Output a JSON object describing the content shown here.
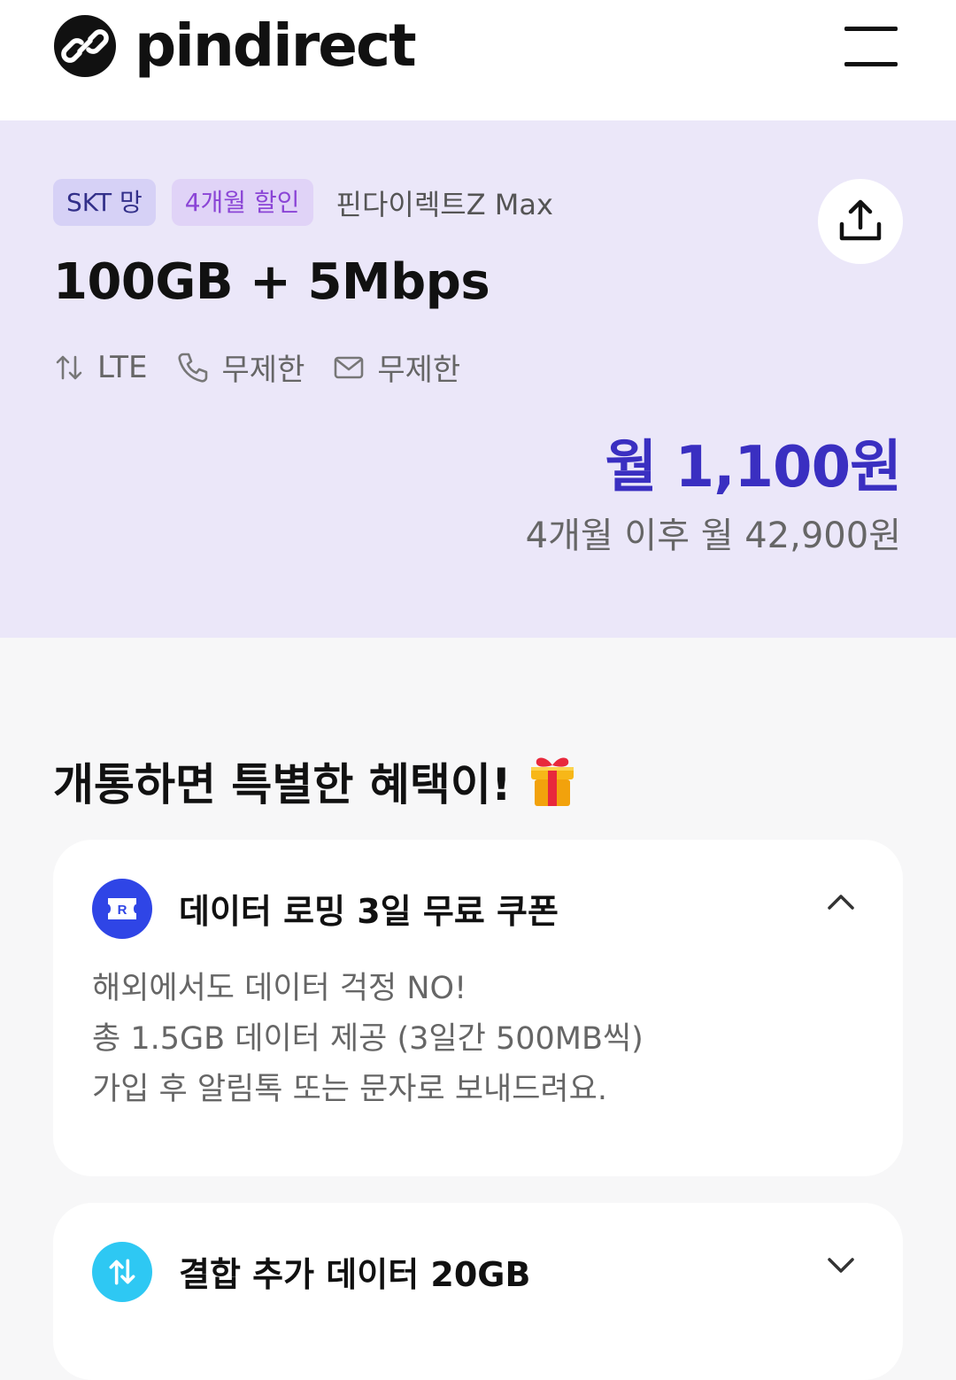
{
  "header": {
    "brand": "pindirect"
  },
  "plan": {
    "network_tag": "SKT 망",
    "discount_tag": "4개월 할인",
    "name": "핀다이렉트Z Max",
    "title": "100GB + 5Mbps",
    "features": {
      "network": "LTE",
      "calls": "무제한",
      "messages": "무제한"
    },
    "price": "월 1,100원",
    "price_after": "4개월 이후 월 42,900원"
  },
  "benefits": {
    "title": "개통하면 특별한 혜택이!",
    "cards": [
      {
        "title": "데이터 로밍 3일 무료 쿠폰",
        "icon": "ticket-icon",
        "expanded": true,
        "lines": [
          "해외에서도 데이터 걱정 NO!",
          "총 1.5GB 데이터 제공 (3일간 500MB씩)",
          "가입 후 알림톡 또는 문자로 보내드려요."
        ]
      },
      {
        "title": "결합 추가 데이터 20GB",
        "icon": "data-arrows-icon",
        "expanded": false
      }
    ]
  },
  "colors": {
    "accent": "#3a2fc1",
    "plan_bg": "#ebe7f9",
    "tag_network_bg": "#d6d1f6",
    "tag_discount_bg": "#e0d3f7",
    "coupon_icon_bg": "#2f45e6",
    "data_icon_bg": "#2ec8f3"
  }
}
